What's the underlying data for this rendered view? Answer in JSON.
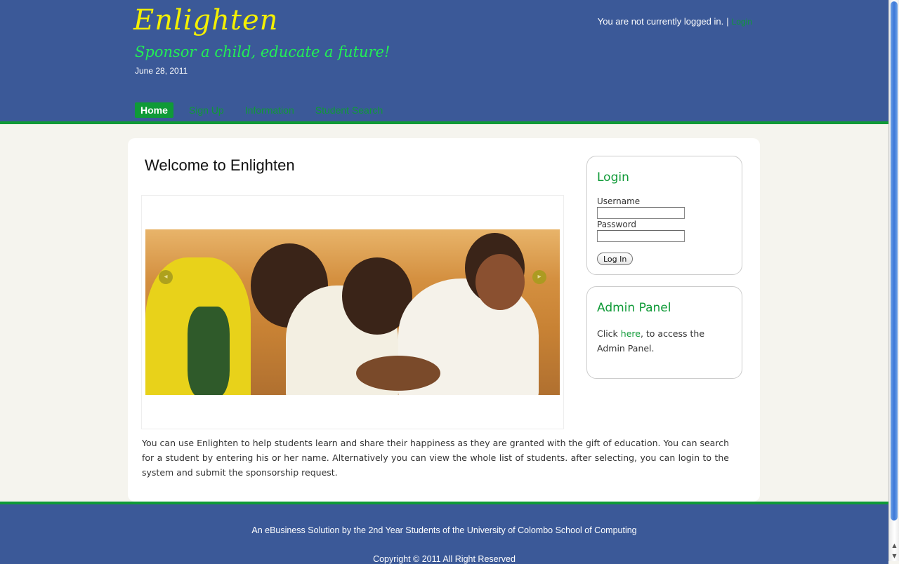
{
  "header": {
    "site_title": "Enlighten",
    "tagline": "Sponsor a child, educate a future!",
    "date": "June 28, 2011",
    "login_status_text": "You are not currently logged in.",
    "login_link": "Login"
  },
  "nav": {
    "items": [
      {
        "label": "Home",
        "active": true
      },
      {
        "label": "Sign Up",
        "active": false
      },
      {
        "label": "Information",
        "active": false
      },
      {
        "label": "Student Search",
        "active": false
      }
    ]
  },
  "main": {
    "title": "Welcome to Enlighten",
    "intro": "You can use Enlighten to help students learn and share their happiness as they are granted with the gift of education. You can search for a student by entering his or her name. Alternatively you can view the whole list of students. after selecting, you can login to the system and submit the sponsorship request.",
    "slider": {
      "prev_icon": "◂",
      "next_icon": "▸"
    }
  },
  "login_box": {
    "title": "Login",
    "username_label": "Username",
    "password_label": "Password",
    "button_label": "Log In"
  },
  "admin_box": {
    "title": "Admin Panel",
    "text_before": "Click ",
    "link_text": "here",
    "text_after": ", to access the Admin Panel."
  },
  "footer": {
    "line1": "An eBusiness Solution by the 2nd Year Students of the University of Colombo School of Computing",
    "line2": "Copyright © 2011 All Right Reserved"
  },
  "colors": {
    "header_bg": "#3b5998",
    "accent_green": "#0f9a37",
    "title_yellow": "#f4f000"
  }
}
